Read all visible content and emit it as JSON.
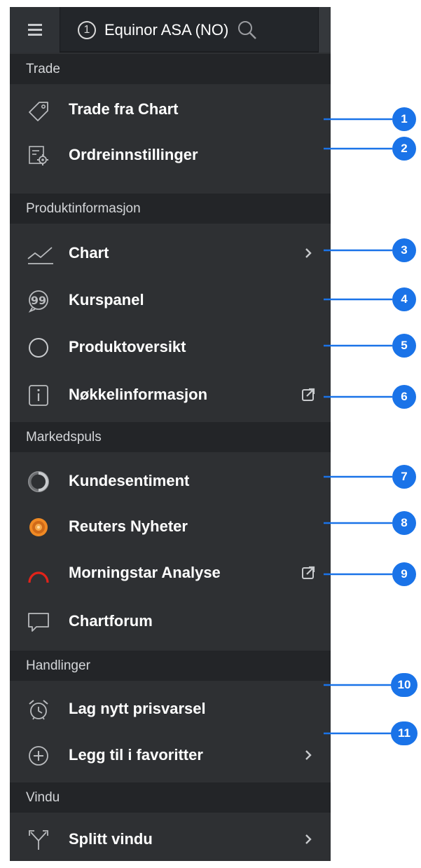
{
  "header": {
    "instrument_number": "1",
    "instrument_name": "Equinor ASA (NO)"
  },
  "sections": {
    "trade": "Trade",
    "product_info": "Produktinformasjon",
    "market_pulse": "Markedspuls",
    "actions": "Handlinger",
    "window": "Vindu"
  },
  "items": {
    "trade_from_chart": "Trade fra Chart",
    "order_settings": "Ordreinnstillinger",
    "chart": "Chart",
    "price_panel": "Kurspanel",
    "product_overview": "Produktoversikt",
    "key_info": "Nøkkelinformasjon",
    "client_sentiment": "Kundesentiment",
    "reuters_news": "Reuters Nyheter",
    "morningstar": "Morningstar Analyse",
    "chart_forum": "Chartforum",
    "new_price_alert": "Lag nytt prisvarsel",
    "add_favorites": "Legg til i favoritter",
    "split_window": "Splitt vindu"
  },
  "callouts": [
    "1",
    "2",
    "3",
    "4",
    "5",
    "6",
    "7",
    "8",
    "9",
    "10",
    "11"
  ],
  "colors": {
    "panel_bg": "#2e3033",
    "section_bg": "#232528",
    "callout_blue": "#1a73e8",
    "morningstar_red": "#e2231a",
    "reuters_orange": "#f08a24"
  },
  "icons": {
    "menu": "hamburger-icon",
    "search": "search-icon",
    "trade": "tag-icon",
    "order_settings": "settings-form-icon",
    "chart": "line-chart-icon",
    "price_panel": "quote-icon",
    "product_overview": "circle-icon",
    "key_info": "info-icon",
    "client_sentiment": "sentiment-ring-icon",
    "reuters": "reuters-logo-icon",
    "morningstar": "morningstar-arc-icon",
    "forum": "speech-bubble-icon",
    "alert": "alarm-clock-icon",
    "favorites": "plus-circle-icon",
    "split": "split-icon",
    "submenu": "chevron-right-icon",
    "external": "external-link-icon"
  }
}
